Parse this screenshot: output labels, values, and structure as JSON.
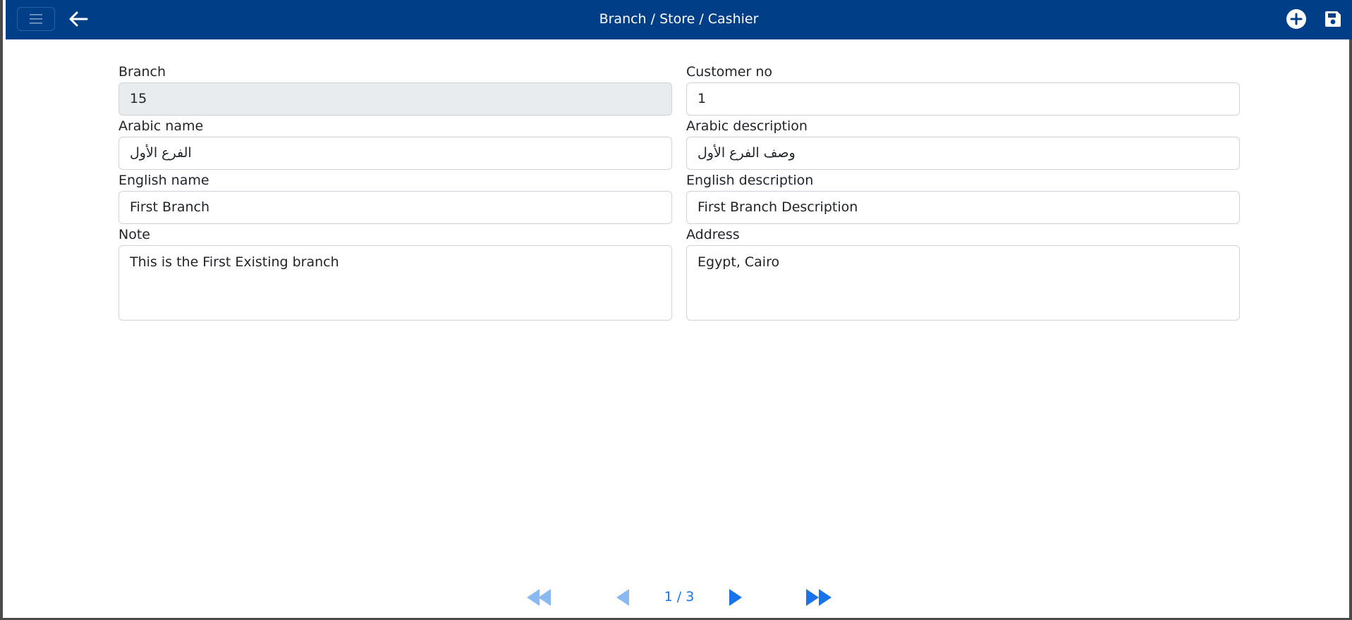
{
  "header": {
    "title": "Branch / Store / Cashier",
    "accent_color": "#003f87",
    "icons": [
      "menu-icon",
      "arrow-left-icon",
      "plus-circle-icon",
      "save-icon"
    ]
  },
  "form": {
    "branch": {
      "label": "Branch",
      "value": "15"
    },
    "customer_no": {
      "label": "Customer no",
      "value": "1"
    },
    "arabic_name": {
      "label": "Arabic name",
      "value": "الفرع الأول"
    },
    "arabic_description": {
      "label": "Arabic description",
      "value": "وصف الفرع الأول"
    },
    "english_name": {
      "label": "English name",
      "value": "First Branch"
    },
    "english_description": {
      "label": "English description",
      "value": "First Branch Description"
    },
    "note": {
      "label": "Note",
      "value": "This is the First Existing branch"
    },
    "address": {
      "label": "Address",
      "value": "Egypt, Cairo"
    }
  },
  "pager": {
    "info": "1 / 3",
    "active_color": "#1a73e8",
    "disabled_color": "#8ab9f1",
    "icons": [
      "first-page-icon",
      "previous-page-icon",
      "next-page-icon",
      "last-page-icon"
    ]
  }
}
